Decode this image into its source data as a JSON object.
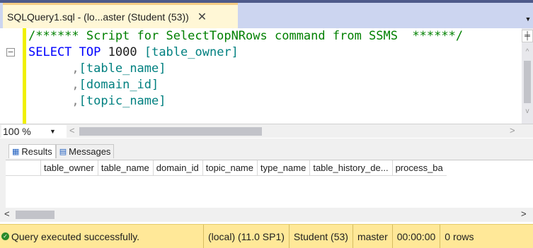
{
  "tab": {
    "title": "SQLQuery1.sql - (lo...aster (Student (53))",
    "close_glyph": "✕",
    "dropdown_glyph": "▼"
  },
  "editor": {
    "lines": [
      {
        "indent": "",
        "parts": [
          {
            "cls": "c-comment",
            "text": "/****** Script for SelectTopNRows command from SSMS  ******/"
          }
        ]
      },
      {
        "indent": "",
        "collapse": "−",
        "parts": [
          {
            "cls": "c-kw",
            "text": "SELECT"
          },
          {
            "cls": "c-punc",
            "text": " "
          },
          {
            "cls": "c-kw",
            "text": "TOP"
          },
          {
            "cls": "c-punc",
            "text": " "
          },
          {
            "cls": "c-num",
            "text": "1000"
          },
          {
            "cls": "c-punc",
            "text": " "
          },
          {
            "cls": "c-id",
            "text": "[table_owner]"
          }
        ]
      },
      {
        "indent": "      ",
        "parts": [
          {
            "cls": "c-punc",
            "text": ","
          },
          {
            "cls": "c-id",
            "text": "[table_name]"
          }
        ]
      },
      {
        "indent": "      ",
        "parts": [
          {
            "cls": "c-punc",
            "text": ","
          },
          {
            "cls": "c-id",
            "text": "[domain_id]"
          }
        ]
      },
      {
        "indent": "      ",
        "parts": [
          {
            "cls": "c-punc",
            "text": ","
          },
          {
            "cls": "c-id",
            "text": "[topic_name]"
          }
        ]
      }
    ]
  },
  "vscroll": {
    "split_glyph": "╪",
    "up_glyph": "^",
    "down_glyph": "v"
  },
  "zoom": {
    "value": "100 %",
    "dropdown_glyph": "▼"
  },
  "hscroll": {
    "left_glyph": "<",
    "right_glyph": ">"
  },
  "results": {
    "tabs": [
      {
        "icon": "▦",
        "label": "Results",
        "active": true
      },
      {
        "icon": "▤",
        "label": "Messages",
        "active": false
      }
    ],
    "columns": [
      "table_owner",
      "table_name",
      "domain_id",
      "topic_name",
      "type_name",
      "table_history_de...",
      "process_ba"
    ]
  },
  "status": {
    "message": "Query executed successfully.",
    "server": "(local) (11.0 SP1)",
    "user": "Student (53)",
    "database": "master",
    "elapsed": "00:00:00",
    "rows": "0 rows"
  }
}
